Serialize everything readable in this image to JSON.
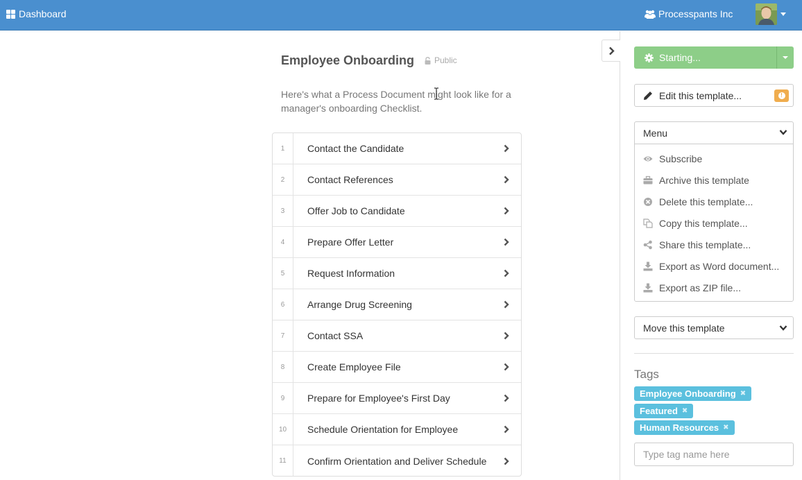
{
  "nav": {
    "dashboard_label": "Dashboard",
    "org_name": "Processpants Inc"
  },
  "document": {
    "title": "Employee Onboarding",
    "visibility": "Public",
    "description": "Here's what a Process Document might look like for a manager's onboarding Checklist."
  },
  "steps": [
    {
      "number": "1",
      "title": "Contact the Candidate"
    },
    {
      "number": "2",
      "title": "Contact References"
    },
    {
      "number": "3",
      "title": "Offer Job to Candidate"
    },
    {
      "number": "4",
      "title": "Prepare Offer Letter"
    },
    {
      "number": "5",
      "title": "Request Information"
    },
    {
      "number": "6",
      "title": "Arrange Drug Screening"
    },
    {
      "number": "7",
      "title": "Contact SSA"
    },
    {
      "number": "8",
      "title": "Create Employee File"
    },
    {
      "number": "9",
      "title": "Prepare for Employee's First Day"
    },
    {
      "number": "10",
      "title": "Schedule Orientation for Employee"
    },
    {
      "number": "11",
      "title": "Confirm Orientation and Deliver Schedule"
    }
  ],
  "sidebar": {
    "start_label": "Starting...",
    "edit_label": "Edit this template...",
    "menu_label": "Menu",
    "menu_items": [
      {
        "label": "Subscribe",
        "icon": "eye-icon"
      },
      {
        "label": "Archive this template",
        "icon": "briefcase-icon"
      },
      {
        "label": "Delete this template...",
        "icon": "delete-circle-icon"
      },
      {
        "label": "Copy this template...",
        "icon": "copy-icon"
      },
      {
        "label": "Share this template...",
        "icon": "share-icon"
      },
      {
        "label": "Export as Word document...",
        "icon": "download-icon"
      },
      {
        "label": "Export as ZIP file...",
        "icon": "download-icon"
      }
    ],
    "move_label": "Move this template",
    "tags_heading": "Tags",
    "tags": [
      "Employee Onboarding",
      "Featured",
      "Human Resources"
    ],
    "tag_input_placeholder": "Type tag name here"
  },
  "colors": {
    "topbar": "#4a8fcf",
    "start_button": "#8dce88",
    "tag": "#5bc0de",
    "warning": "#f0ad4e"
  }
}
